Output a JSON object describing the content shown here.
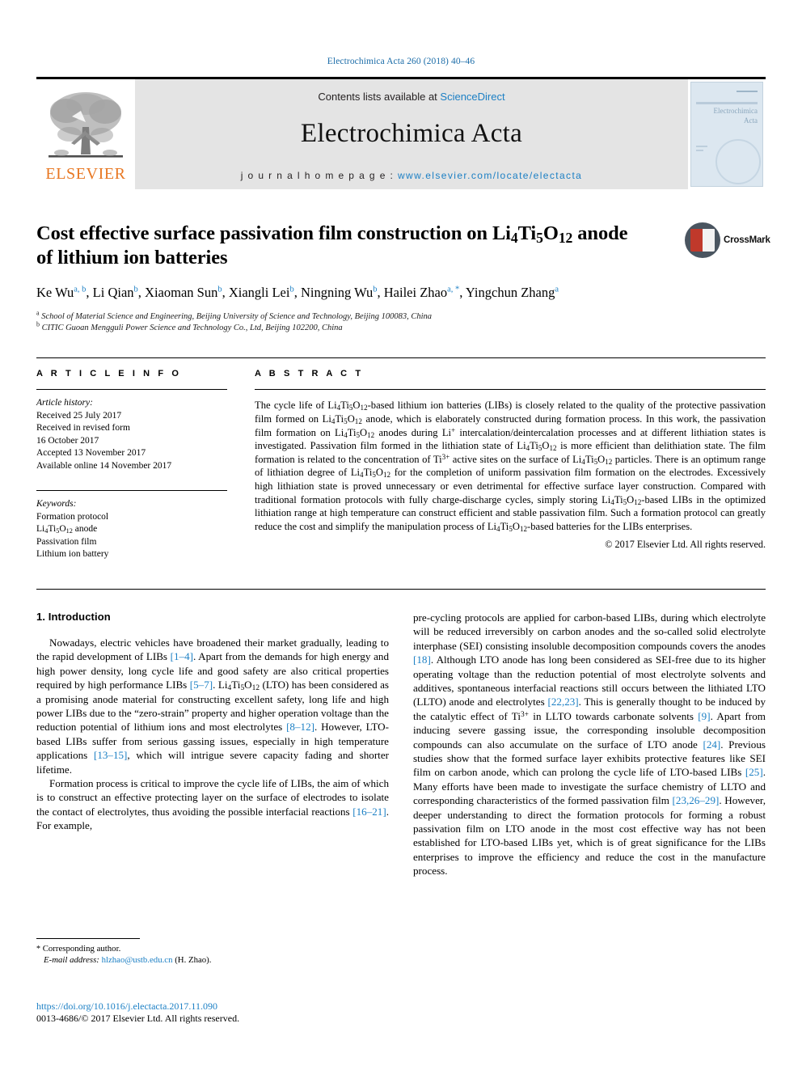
{
  "running_head": "Electrochimica Acta 260 (2018) 40–46",
  "masthead": {
    "publisher_logo_text": "ELSEVIER",
    "contents_prefix": "Contents lists available at ",
    "contents_link": "ScienceDirect",
    "journal_title": "Electrochimica Acta",
    "homepage_prefix": "j o u r n a l   h o m e p a g e :  ",
    "homepage_url": "www.elsevier.com/locate/electacta",
    "cover_title_line1": "Electrochimica",
    "cover_title_line2": "Acta"
  },
  "article": {
    "title_line1_a": "Cost effective surface passivation film construction on Li",
    "title_line1_sub1": "4",
    "title_line1_b": "Ti",
    "title_line1_sub2": "5",
    "title_line1_c": "O",
    "title_line1_sub3": "12",
    "title_line1_d": " anode",
    "title_line2": "of lithium ion batteries",
    "crossmark_label": "CrossMark",
    "authors": [
      {
        "name": "Ke Wu",
        "sup": "a, b",
        "sep": ", "
      },
      {
        "name": "Li Qian",
        "sup": "b",
        "sep": ", "
      },
      {
        "name": "Xiaoman Sun",
        "sup": "b",
        "sep": ", "
      },
      {
        "name": "Xiangli Lei",
        "sup": "b",
        "sep": ", "
      },
      {
        "name": "Ningning Wu",
        "sup": "b",
        "sep": ", "
      },
      {
        "name": "Hailei Zhao",
        "sup": "a, *",
        "sep": ", "
      },
      {
        "name": "Yingchun Zhang",
        "sup": "a",
        "sep": ""
      }
    ],
    "affiliations": [
      {
        "mark": "a",
        "text": "School of Material Science and Engineering, Beijing University of Science and Technology, Beijing 100083, China"
      },
      {
        "mark": "b",
        "text": "CITIC Guoan Mengguli Power Science and Technology Co., Ltd, Beijing 102200, China"
      }
    ]
  },
  "article_info": {
    "heading": "A R T I C L E  I N F O",
    "history_label": "Article history:",
    "history": [
      "Received 25 July 2017",
      "Received in revised form",
      "16 October 2017",
      "Accepted 13 November 2017",
      "Available online 14 November 2017"
    ],
    "keywords_label": "Keywords:",
    "keywords": [
      "Formation protocol",
      "Li4Ti5O12 anode",
      "Passivation film",
      "Lithium ion battery"
    ]
  },
  "abstract": {
    "heading": "A B S T R A C T",
    "text": "The cycle life of Li4Ti5O12-based lithium ion batteries (LIBs) is closely related to the quality of the protective passivation film formed on Li4Ti5O12 anode, which is elaborately constructed during formation process. In this work, the passivation film formation on Li4Ti5O12 anodes during Li+ intercalation/deintercalation processes and at different lithiation states is investigated. Passivation film formed in the lithiation state of Li4Ti5O12 is more efficient than delithiation state. The film formation is related to the concentration of Ti3+ active sites on the surface of Li4Ti5O12 particles. There is an optimum range of lithiation degree of Li4Ti5O12 for the completion of uniform passivation film formation on the electrodes. Excessively high lithiation state is proved unnecessary or even detrimental for effective surface layer construction. Compared with traditional formation protocols with fully charge-discharge cycles, simply storing Li4Ti5O12-based LIBs in the optimized lithiation range at high temperature can construct efficient and stable passivation film. Such a formation protocol can greatly reduce the cost and simplify the manipulation process of Li4Ti5O12-based batteries for the LIBs enterprises.",
    "copyright": "© 2017 Elsevier Ltd. All rights reserved."
  },
  "body": {
    "section_heading": "1. Introduction",
    "paragraph_1": "Nowadays, electric vehicles have broadened their market gradually, leading to the rapid development of LIBs [1–4]. Apart from the demands for high energy and high power density, long cycle life and good safety are also critical properties required by high performance LIBs [5–7]. Li4Ti5O12 (LTO) has been considered as a promising anode material for constructing excellent safety, long life and high power LIBs due to the “zero-strain” property and higher operation voltage than the reduction potential of lithium ions and most electrolytes [8–12]. However, LTO-based LIBs suffer from serious gassing issues, especially in high temperature applications [13–15], which will intrigue severe capacity fading and shorter lifetime.",
    "paragraph_2": "Formation process is critical to improve the cycle life of LIBs, the aim of which is to construct an effective protecting layer on the surface of electrodes to isolate the contact of electrolytes, thus avoiding the possible interfacial reactions [16–21]. For example, pre-cycling protocols are applied for carbon-based LIBs, during which electrolyte will be reduced irreversibly on carbon anodes and the so-called solid electrolyte interphase (SEI) consisting insoluble decomposition compounds covers the anodes [18]. Although LTO anode has long been considered as SEI-free due to its higher operating voltage than the reduction potential of most electrolyte solvents and additives, spontaneous interfacial reactions still occurs between the lithiated LTO (LLTO) anode and electrolytes [22,23]. This is generally thought to be induced by the catalytic effect of Ti3+ in LLTO towards carbonate solvents [9]. Apart from inducing severe gassing issue, the corresponding insoluble decomposition compounds can also accumulate on the surface of LTO anode [24]. Previous studies show that the formed surface layer exhibits protective features like SEI film on carbon anode, which can prolong the cycle life of LTO-based LIBs [25]. Many efforts have been made to investigate the surface chemistry of LLTO and corresponding characteristics of the formed passivation film [23,26–29]. However, deeper understanding to direct the formation protocols for forming a robust passivation film on LTO anode in the most cost effective way has not been established for LTO-based LIBs yet, which is of great significance for the LIBs enterprises to improve the efficiency and reduce the cost in the manufacture process."
  },
  "footnote": {
    "corresponding_marker": "*",
    "corresponding_text": "Corresponding author.",
    "email_label": "E-mail address:",
    "email": "hlzhao@ustb.edu.cn",
    "email_suffix": "(H. Zhao)."
  },
  "footer": {
    "doi": "https://doi.org/10.1016/j.electacta.2017.11.090",
    "issn_line": "0013-4686/© 2017 Elsevier Ltd. All rights reserved."
  },
  "colors": {
    "link": "#1b7fc4",
    "elsevier_orange": "#e87722",
    "masthead_bg": "#e4e4e4"
  }
}
